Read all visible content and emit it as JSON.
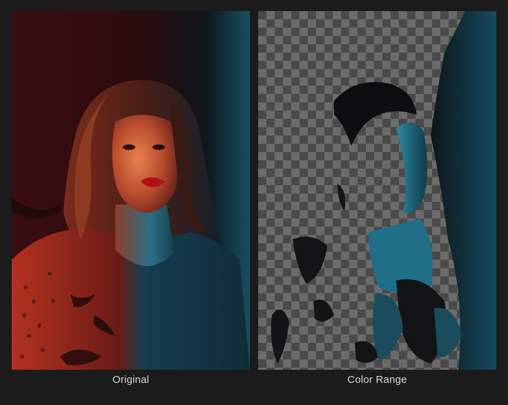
{
  "captions": {
    "original": "Original",
    "color_range": "Color Range"
  },
  "panels": [
    {
      "id": "original",
      "content": "portrait-photo"
    },
    {
      "id": "color_range",
      "content": "masked-portrait-on-transparency-checkerboard"
    }
  ],
  "colors": {
    "background": "#1b1b1b",
    "caption_text": "#d9d9d9",
    "red_light": "#c2311f",
    "blue_light": "#1e6f8a",
    "checker_light": "#6b6b6b",
    "checker_dark": "#4a4a4a"
  }
}
